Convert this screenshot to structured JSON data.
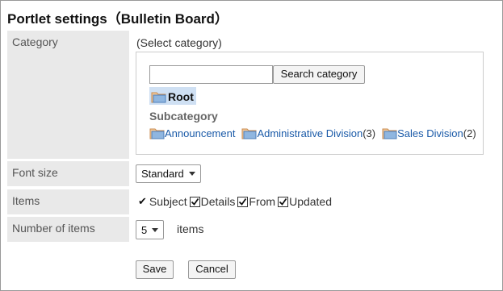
{
  "title": "Portlet settings（Bulletin Board）",
  "category": {
    "label": "Category",
    "select_text": "(Select category)",
    "search_placeholder": "",
    "search_button": "Search category",
    "root": "Root",
    "subcategory_title": "Subcategory",
    "subcategories": [
      {
        "name": "Announcement",
        "count": ""
      },
      {
        "name": "Administrative Division",
        "count": "(3)"
      },
      {
        "name": "Sales Division",
        "count": "(2)"
      }
    ]
  },
  "font_size": {
    "label": "Font size",
    "value": "Standard"
  },
  "items": {
    "label": "Items",
    "fields": [
      {
        "name": "Subject",
        "state": "fixed"
      },
      {
        "name": "Details",
        "state": "checked"
      },
      {
        "name": "From",
        "state": "checked"
      },
      {
        "name": "Updated",
        "state": "checked"
      }
    ]
  },
  "number_of_items": {
    "label": "Number of items",
    "value": "5",
    "unit": "items"
  },
  "buttons": {
    "save": "Save",
    "cancel": "Cancel"
  },
  "colors": {
    "link": "#1a5aa8",
    "label_bg": "#e9e9e9",
    "root_highlight": "#cfe0f3"
  },
  "icons": {
    "folder": "folder-icon",
    "check": "check-icon",
    "caret": "caret-down-icon"
  }
}
